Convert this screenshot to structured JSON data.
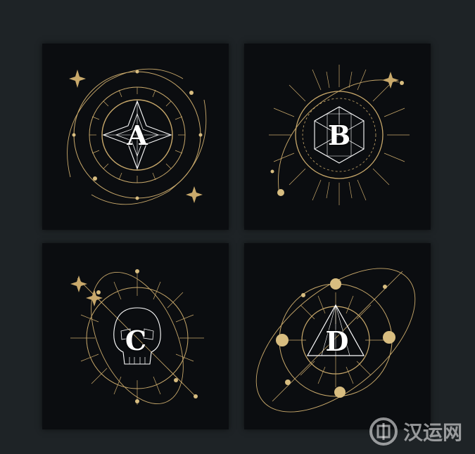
{
  "cards": [
    {
      "id": "A",
      "letter": "A"
    },
    {
      "id": "B",
      "letter": "B"
    },
    {
      "id": "C",
      "letter": "C"
    },
    {
      "id": "D",
      "letter": "D"
    }
  ],
  "watermark": {
    "text": "汉运网"
  },
  "colors": {
    "background": "#1e2326",
    "panel": "#0b0d10",
    "gold": "#c9a96b",
    "letter": "#ffffff"
  }
}
